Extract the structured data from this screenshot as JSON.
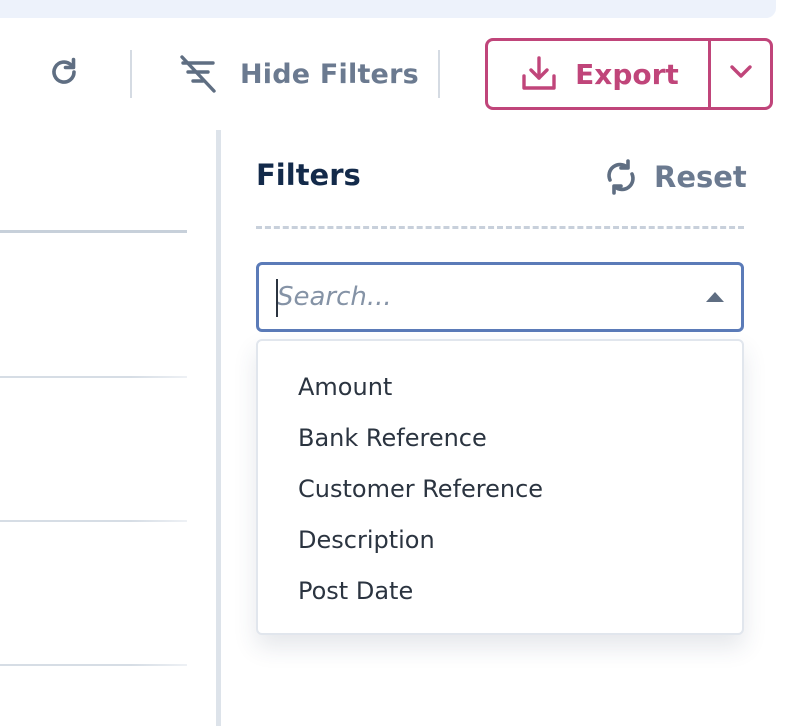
{
  "toolbar": {
    "refresh_icon": "refresh-icon",
    "hide_filters": {
      "label": "Hide Filters",
      "icon": "filter-off-icon"
    },
    "export": {
      "label": "Export",
      "icon": "download-icon",
      "toggle_icon": "chevron-down-icon"
    }
  },
  "filters_panel": {
    "title": "Filters",
    "reset": {
      "label": "Reset",
      "icon": "sync-icon"
    },
    "search": {
      "placeholder": "Search...",
      "value": "",
      "toggle_icon": "caret-up-icon"
    },
    "options": [
      "Amount",
      "Bank Reference",
      "Customer Reference",
      "Description",
      "Post Date"
    ]
  },
  "colors": {
    "accent": "#c0457a",
    "focus_border": "#5b7bb8",
    "title": "#132a4a",
    "muted": "#6b7a90",
    "top_strip": "#edf2fb"
  }
}
